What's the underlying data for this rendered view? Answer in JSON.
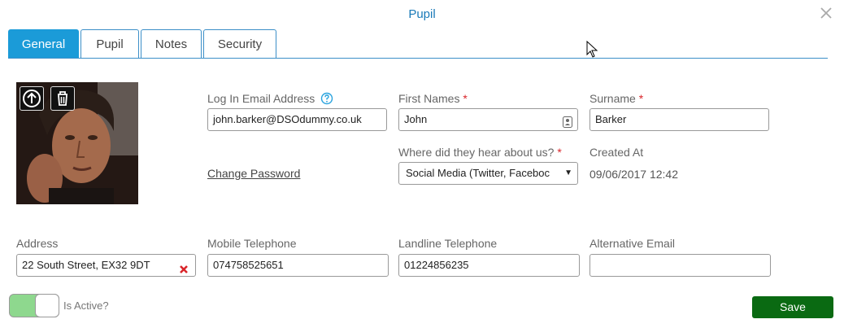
{
  "dialog": {
    "title": "Pupil"
  },
  "tabs": [
    {
      "label": "General",
      "active": true
    },
    {
      "label": "Pupil",
      "active": false
    },
    {
      "label": "Notes",
      "active": false
    },
    {
      "label": "Security",
      "active": false
    }
  ],
  "form": {
    "login_email": {
      "label": "Log In Email Address",
      "value": "john.barker@DSOdummy.co.uk"
    },
    "first_names": {
      "label": "First Names",
      "required_mark": "*",
      "value": "John"
    },
    "surname": {
      "label": "Surname",
      "required_mark": "*",
      "value": "Barker"
    },
    "change_password": "Change Password",
    "heard_about": {
      "label": "Where did they hear about us?",
      "required_mark": "*",
      "value": "Social Media (Twitter, Faceboc"
    },
    "created_at": {
      "label": "Created At",
      "value": "09/06/2017 12:42"
    },
    "address": {
      "label": "Address",
      "value": "22 South Street, EX32 9DT"
    },
    "mobile": {
      "label": "Mobile Telephone",
      "value": "074758525651"
    },
    "landline": {
      "label": "Landline Telephone",
      "value": "01224856235"
    },
    "alt_email": {
      "label": "Alternative Email",
      "value": ""
    },
    "is_active": {
      "label": "Is Active?",
      "checked": true
    }
  },
  "actions": {
    "save": "Save"
  },
  "colors": {
    "accent": "#1b9bd8",
    "title": "#1a7ab8",
    "save": "#0a6a12",
    "required": "#d9252a",
    "toggle_on": "#8ed88e"
  },
  "icons": [
    "close-icon",
    "upload-icon",
    "trash-icon",
    "help-icon",
    "contact-card-icon",
    "chevron-down-icon",
    "clear-x-icon",
    "mouse-cursor-icon"
  ]
}
